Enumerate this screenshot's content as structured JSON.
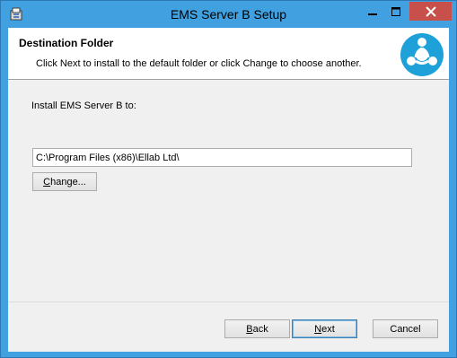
{
  "window": {
    "title": "EMS Server B Setup",
    "controls": {
      "minimize_icon": "minimize-icon",
      "maximize_icon": "maximize-icon",
      "close_icon": "close-icon"
    },
    "colors": {
      "titlebar": "#41a0e0",
      "close_button": "#c7504a",
      "client_bg": "#f0f0f0"
    }
  },
  "banner": {
    "title": "Destination Folder",
    "subtitle": "Click Next to install to the default folder or click Change to choose another.",
    "logo_icon": "ellab-logo-icon",
    "logo_color": "#1da1d8"
  },
  "body": {
    "install_label": "Install EMS Server B to:",
    "path_value": "C:\\Program Files (x86)\\Ellab Ltd\\",
    "change_button": {
      "accel": "C",
      "rest": "hange..."
    }
  },
  "footer": {
    "back_button": {
      "accel": "B",
      "rest": "ack"
    },
    "next_button": {
      "accel": "N",
      "rest": "ext"
    },
    "cancel_button": "Cancel"
  }
}
